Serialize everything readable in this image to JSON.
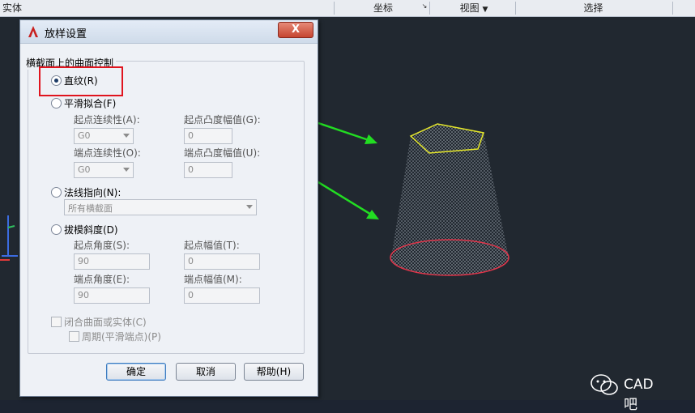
{
  "ribbon": {
    "left_partial": "实体",
    "coordinates": "坐标",
    "view": "视图",
    "select": "选择"
  },
  "dialog": {
    "title": "放样设置",
    "close_label": "X",
    "group_title": "横截面上的曲面控制",
    "ruled": "直纹(R)",
    "smooth_fit": "平滑拟合(F)",
    "start_continuity_label": "起点连续性(A):",
    "start_continuity_value": "G0",
    "start_bulge_label": "起点凸度幅值(G):",
    "start_bulge_value": "0",
    "end_continuity_label": "端点连续性(O):",
    "end_continuity_value": "G0",
    "end_bulge_label": "端点凸度幅值(U):",
    "end_bulge_value": "0",
    "normal_to": "法线指向(N):",
    "normal_to_value": "所有横截面",
    "draft_angles": "拔模斜度(D)",
    "start_angle_label": "起点角度(S):",
    "start_angle_value": "90",
    "start_magnitude_label": "起点幅值(T):",
    "start_magnitude_value": "0",
    "end_angle_label": "端点角度(E):",
    "end_angle_value": "90",
    "end_magnitude_label": "端点幅值(M):",
    "end_magnitude_value": "0",
    "close_surface": "闭合曲面或实体(C)",
    "periodic": "周期(平滑端点)(P)",
    "ok": "确定",
    "cancel": "取消",
    "help": "帮助(H)"
  },
  "watermark": {
    "text": "CAD吧"
  },
  "colors": {
    "highlight_box": "#e0141e",
    "arrow": "#22dd22",
    "top_profile": "#e6e82a",
    "bottom_profile": "#e0354a",
    "viewport_bg": "#212830"
  },
  "icons": {
    "app": "autocad-a-icon",
    "watermark": "wechat-icon"
  }
}
